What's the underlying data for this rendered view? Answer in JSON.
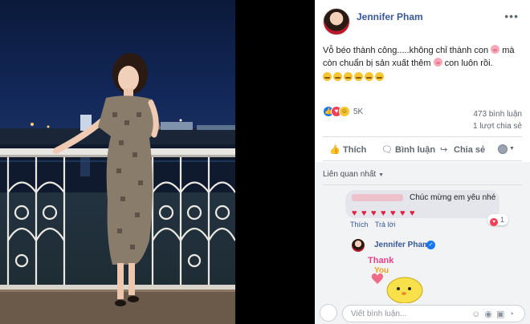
{
  "post": {
    "author": "Jennifer Pham",
    "text_line1": "Vỗ béo thành công.....không chỉ thành con",
    "text_line1b": "mà",
    "text_line2a": "còn chuẩn bị sản xuất thêm",
    "text_line2b": "con luôn rồi.",
    "reaction_count": "5K",
    "comment_count": "473 bình luận",
    "share_count": "1 lượt chia sẻ",
    "more_icon": "•••"
  },
  "actions": {
    "like": "Thích",
    "comment": "Bình luận",
    "share": "Chia sẻ"
  },
  "comments": {
    "sort_label": "Liên quan nhất",
    "first": {
      "text": "Chúc mừng em yêu nhé",
      "like": "Thích",
      "reply": "Trả lời",
      "reaction_count": "1"
    },
    "reply": {
      "author": "Jennifer Pham",
      "sticker_text_1": "Thank",
      "sticker_text_2": "You"
    },
    "composer_placeholder": "Viết bình luận..."
  },
  "colors": {
    "link_blue": "#385898",
    "like_blue": "#1877f2",
    "love_red": "#f33e58"
  }
}
